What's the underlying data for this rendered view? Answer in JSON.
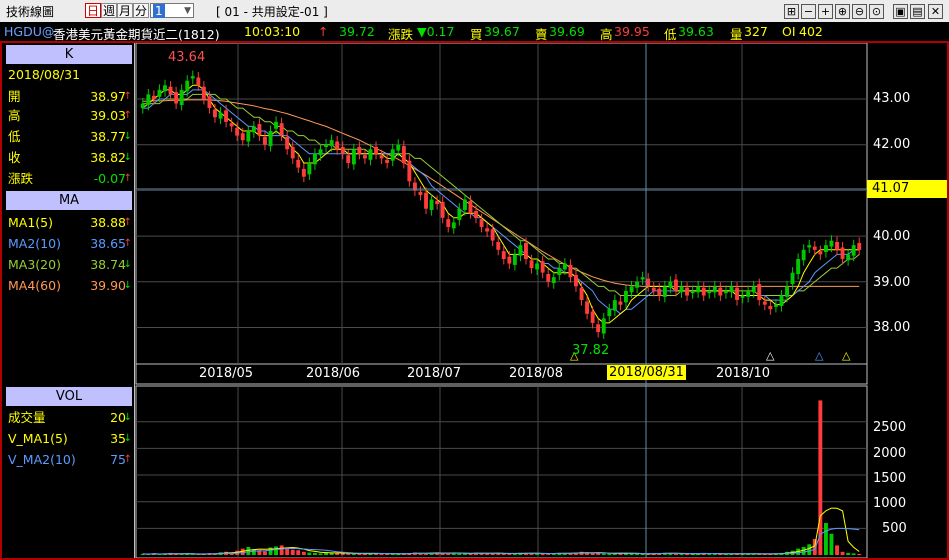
{
  "toolbar": {
    "title": "技術線圖",
    "periods": [
      "日",
      "週",
      "月",
      "分"
    ],
    "selected_period": "日",
    "interval_value": "1",
    "layout_label": "[ 01 - 共用設定-01 ]",
    "icons": [
      "pin-icon",
      "minus-icon",
      "plus-icon",
      "zoom-in-icon",
      "zoom-out-icon",
      "zoom-reset-icon",
      "save-icon",
      "print-icon",
      "close-icon"
    ]
  },
  "quote": {
    "symbol": "HGDU@",
    "name": "香港美元黃金期貨近二(1812)",
    "time": "10:03:10",
    "arrow": "↑",
    "price": "39.72",
    "change_label": "漲跌",
    "change": "▼0.17",
    "bid_label": "買",
    "bid": "39.67",
    "ask_label": "賣",
    "ask": "39.69",
    "high_label": "高",
    "high": "39.95",
    "low_label": "低",
    "low": "39.63",
    "vol_label": "量",
    "vol": "327",
    "oi_label": "OI",
    "oi": "402"
  },
  "k_panel": {
    "header": "K",
    "date": "2018/08/31",
    "rows": [
      {
        "label": "開",
        "value": "38.97",
        "arrow": "↑"
      },
      {
        "label": "高",
        "value": "39.03",
        "arrow": "↑"
      },
      {
        "label": "低",
        "value": "38.77",
        "arrow": "↓"
      },
      {
        "label": "收",
        "value": "38.82",
        "arrow": "↓"
      },
      {
        "label": "漲跌",
        "value": "-0.07",
        "arrow": "↑"
      }
    ]
  },
  "ma_panel": {
    "header": "MA",
    "rows": [
      {
        "label": "MA1(5)",
        "value": "38.88",
        "arrow": "↑",
        "color": "#ffff00"
      },
      {
        "label": "MA2(10)",
        "value": "38.65",
        "arrow": "↑",
        "color": "#5a9cff"
      },
      {
        "label": "MA3(20)",
        "value": "38.74",
        "arrow": "↓",
        "color": "#9acd32"
      },
      {
        "label": "MA4(60)",
        "value": "39.90",
        "arrow": "↓",
        "color": "#ff9955"
      }
    ]
  },
  "vol_panel": {
    "header": "VOL",
    "rows": [
      {
        "label": "成交量",
        "value": "20",
        "arrow": "↓",
        "color": "#ffff00"
      },
      {
        "label": "V_MA1(5)",
        "value": "35",
        "arrow": "↓",
        "color": "#ffff00"
      },
      {
        "label": "V_MA2(10)",
        "value": "75",
        "arrow": "↑",
        "color": "#5a9cff"
      }
    ]
  },
  "colors": {
    "up": "#00c800",
    "down": "#ff3c3c",
    "grid": "#505050",
    "crosshair": "#5b8fa8",
    "highlight": "#ffff00"
  },
  "chart_data": {
    "type": "candlestick",
    "price_axis": {
      "ticks": [
        "43.00",
        "42.00",
        "41.00",
        "40.00",
        "39.00",
        "38.00"
      ],
      "crosshair_value": "41.07"
    },
    "x_axis": {
      "ticks": [
        "2018/05",
        "2018/06",
        "2018/07",
        "2018/08",
        "2018/08/31",
        "2018/10"
      ],
      "highlighted": "2018/08/31"
    },
    "annotations": {
      "high_mark": "43.64",
      "low_mark": "37.82"
    },
    "volume_axis": {
      "ticks": [
        "2500",
        "2000",
        "1500",
        "1000",
        "500"
      ]
    },
    "series_close": [
      42.9,
      43.1,
      43.0,
      43.2,
      43.3,
      43.1,
      42.9,
      43.2,
      43.4,
      43.5,
      43.3,
      43.0,
      42.8,
      42.6,
      42.7,
      42.5,
      42.4,
      42.2,
      42.1,
      42.3,
      42.4,
      42.2,
      42.0,
      42.3,
      42.5,
      42.2,
      41.9,
      41.7,
      41.5,
      41.3,
      41.6,
      41.8,
      41.9,
      42.0,
      42.1,
      41.9,
      41.8,
      41.6,
      41.9,
      41.8,
      41.7,
      41.9,
      41.8,
      41.7,
      41.6,
      41.9,
      42.0,
      41.6,
      41.2,
      41.0,
      40.9,
      40.6,
      40.8,
      40.7,
      40.4,
      40.2,
      40.3,
      40.6,
      40.8,
      40.5,
      40.4,
      40.2,
      40.1,
      39.9,
      39.7,
      39.5,
      39.4,
      39.6,
      39.8,
      39.5,
      39.3,
      39.4,
      39.2,
      39.0,
      39.1,
      39.3,
      39.4,
      39.1,
      38.9,
      38.6,
      38.3,
      38.1,
      37.9,
      38.2,
      38.4,
      38.6,
      38.5,
      38.8,
      38.9,
      39.0,
      39.1,
      38.9,
      38.8,
      38.7,
      38.9,
      39.0,
      38.8,
      38.9,
      38.7,
      38.8,
      38.9,
      38.7,
      38.8,
      38.9,
      38.7,
      38.8,
      38.9,
      38.6,
      38.7,
      38.8,
      38.9,
      38.6,
      38.5,
      38.4,
      38.5,
      38.7,
      38.9,
      39.2,
      39.5,
      39.7,
      39.8,
      39.7,
      39.6,
      39.8,
      39.9,
      39.7,
      39.5,
      39.6,
      39.8,
      39.7
    ],
    "series_ma5": [
      42.8,
      42.9,
      43.0,
      43.1,
      43.2,
      43.2,
      43.1,
      43.1,
      43.2,
      43.3,
      43.3,
      43.2,
      43.0,
      42.8,
      42.7,
      42.6,
      42.5,
      42.4,
      42.3,
      42.3,
      42.3,
      42.2,
      42.2,
      42.2,
      42.3,
      42.2,
      42.1,
      41.9,
      41.8,
      41.6,
      41.6,
      41.6,
      41.7,
      41.8,
      41.9,
      41.9,
      41.9,
      41.8,
      41.8,
      41.8,
      41.8,
      41.8,
      41.8,
      41.8,
      41.7,
      41.7,
      41.8,
      41.7,
      41.6,
      41.4,
      41.2,
      41.0,
      40.9,
      40.8,
      40.7,
      40.5,
      40.4,
      40.4,
      40.5,
      40.5,
      40.5,
      40.4,
      40.3,
      40.2,
      40.0,
      39.8,
      39.6,
      39.6,
      39.6,
      39.6,
      39.5,
      39.5,
      39.4,
      39.3,
      39.2,
      39.2,
      39.2,
      39.2,
      39.1,
      38.9,
      38.7,
      38.4,
      38.2,
      38.1,
      38.1,
      38.2,
      38.3,
      38.4,
      38.6,
      38.7,
      38.8,
      38.9,
      38.9,
      38.9,
      38.9,
      38.9,
      38.8,
      38.8,
      38.8,
      38.8,
      38.8,
      38.8,
      38.8,
      38.8,
      38.8,
      38.8,
      38.8,
      38.7,
      38.7,
      38.7,
      38.7,
      38.7,
      38.6,
      38.6,
      38.5,
      38.5,
      38.6,
      38.7,
      38.9,
      39.2,
      39.4,
      39.6,
      39.7,
      39.7,
      39.7,
      39.7,
      39.7,
      39.7,
      39.7,
      39.7
    ],
    "series_ma10": [
      42.8,
      42.8,
      42.9,
      43.0,
      43.0,
      43.1,
      43.1,
      43.1,
      43.1,
      43.2,
      43.2,
      43.2,
      43.1,
      43.0,
      42.9,
      42.8,
      42.7,
      42.6,
      42.5,
      42.4,
      42.4,
      42.3,
      42.3,
      42.2,
      42.2,
      42.2,
      42.2,
      42.1,
      42.0,
      41.9,
      41.8,
      41.8,
      41.8,
      41.8,
      41.8,
      41.8,
      41.8,
      41.8,
      41.8,
      41.8,
      41.8,
      41.8,
      41.8,
      41.8,
      41.8,
      41.8,
      41.8,
      41.7,
      41.6,
      41.5,
      41.4,
      41.3,
      41.1,
      41.0,
      40.9,
      40.8,
      40.7,
      40.6,
      40.5,
      40.5,
      40.4,
      40.4,
      40.3,
      40.2,
      40.1,
      40.0,
      39.9,
      39.8,
      39.7,
      39.6,
      39.5,
      39.5,
      39.4,
      39.4,
      39.3,
      39.3,
      39.2,
      39.2,
      39.1,
      39.0,
      38.9,
      38.8,
      38.6,
      38.5,
      38.4,
      38.4,
      38.3,
      38.4,
      38.4,
      38.5,
      38.6,
      38.7,
      38.8,
      38.8,
      38.8,
      38.8,
      38.8,
      38.8,
      38.8,
      38.8,
      38.8,
      38.8,
      38.8,
      38.8,
      38.8,
      38.8,
      38.8,
      38.7,
      38.7,
      38.7,
      38.7,
      38.7,
      38.7,
      38.6,
      38.6,
      38.6,
      38.6,
      38.7,
      38.8,
      38.9,
      39.0,
      39.2,
      39.3,
      39.4,
      39.5,
      39.6,
      39.6,
      39.6,
      39.7,
      39.7
    ],
    "series_ma20": [
      42.9,
      42.9,
      42.9,
      42.9,
      43.0,
      43.0,
      43.0,
      43.0,
      43.0,
      43.1,
      43.1,
      43.1,
      43.1,
      43.1,
      43.0,
      43.0,
      42.9,
      42.8,
      42.8,
      42.7,
      42.6,
      42.6,
      42.5,
      42.5,
      42.4,
      42.4,
      42.3,
      42.3,
      42.2,
      42.2,
      42.1,
      42.1,
      42.0,
      42.0,
      42.0,
      41.9,
      41.9,
      41.9,
      41.9,
      41.9,
      41.9,
      41.8,
      41.8,
      41.8,
      41.8,
      41.8,
      41.8,
      41.8,
      41.8,
      41.7,
      41.7,
      41.6,
      41.5,
      41.4,
      41.3,
      41.2,
      41.1,
      41.0,
      40.9,
      40.8,
      40.7,
      40.6,
      40.5,
      40.4,
      40.3,
      40.2,
      40.1,
      40.0,
      39.9,
      39.9,
      39.8,
      39.7,
      39.6,
      39.5,
      39.5,
      39.4,
      39.4,
      39.3,
      39.3,
      39.2,
      39.1,
      39.0,
      38.9,
      38.9,
      38.8,
      38.8,
      38.7,
      38.7,
      38.7,
      38.7,
      38.7,
      38.7,
      38.7,
      38.7,
      38.7,
      38.7,
      38.7,
      38.8,
      38.8,
      38.8,
      38.8,
      38.8,
      38.8,
      38.8,
      38.8,
      38.8,
      38.8,
      38.8,
      38.8,
      38.8,
      38.8,
      38.7,
      38.7,
      38.7,
      38.7,
      38.7,
      38.7,
      38.7,
      38.8,
      38.8,
      38.9,
      39.0,
      39.1,
      39.2,
      39.3,
      39.3,
      39.4,
      39.5,
      39.5,
      39.6
    ],
    "series_ma60": [
      42.95,
      42.95,
      42.96,
      42.96,
      42.96,
      42.97,
      42.97,
      42.97,
      42.98,
      42.98,
      42.98,
      42.98,
      42.98,
      42.97,
      42.96,
      42.95,
      42.93,
      42.91,
      42.89,
      42.87,
      42.85,
      42.82,
      42.79,
      42.77,
      42.74,
      42.71,
      42.68,
      42.64,
      42.6,
      42.56,
      42.52,
      42.48,
      42.44,
      42.4,
      42.35,
      42.3,
      42.25,
      42.2,
      42.15,
      42.1,
      42.04,
      41.98,
      41.92,
      41.86,
      41.8,
      41.74,
      41.68,
      41.61,
      41.54,
      41.47,
      41.4,
      41.33,
      41.25,
      41.17,
      41.09,
      41.01,
      40.93,
      40.85,
      40.77,
      40.69,
      40.61,
      40.53,
      40.45,
      40.37,
      40.29,
      40.21,
      40.13,
      40.05,
      39.97,
      39.9,
      39.82,
      39.74,
      39.66,
      39.59,
      39.52,
      39.45,
      39.38,
      39.32,
      39.26,
      39.21,
      39.16,
      39.11,
      39.07,
      39.03,
      39.0,
      38.97,
      38.95,
      38.93,
      38.92,
      38.91,
      38.9,
      38.9,
      38.9,
      38.9,
      38.9,
      38.9,
      38.9,
      38.9,
      38.9,
      38.9,
      38.9,
      38.9,
      38.9,
      38.9,
      38.9,
      38.9,
      38.9,
      38.9,
      38.9,
      38.9,
      38.9,
      38.9,
      38.9,
      38.9,
      38.9,
      38.9,
      38.9,
      38.9,
      38.9,
      38.9,
      38.9,
      38.9,
      38.9,
      38.9,
      38.9,
      38.9,
      38.9,
      38.9,
      38.9,
      38.9
    ],
    "series_volume": [
      20,
      15,
      30,
      10,
      25,
      40,
      20,
      15,
      30,
      12,
      8,
      20,
      35,
      25,
      50,
      60,
      40,
      80,
      120,
      150,
      110,
      90,
      70,
      140,
      160,
      180,
      120,
      100,
      90,
      60,
      45,
      40,
      30,
      50,
      35,
      40,
      30,
      25,
      20,
      25,
      30,
      35,
      28,
      22,
      18,
      30,
      25,
      20,
      35,
      45,
      30,
      25,
      40,
      50,
      35,
      28,
      30,
      40,
      25,
      20,
      45,
      38,
      30,
      35,
      28,
      22,
      25,
      30,
      40,
      35,
      30,
      25,
      20,
      28,
      35,
      40,
      30,
      25,
      45,
      60,
      50,
      40,
      30,
      25,
      20,
      35,
      40,
      30,
      25,
      20,
      18,
      25,
      30,
      35,
      40,
      30,
      25,
      20,
      22,
      28,
      30,
      35,
      25,
      20,
      18,
      22,
      25,
      30,
      28,
      20,
      15,
      18,
      22,
      25,
      30,
      40,
      60,
      80,
      120,
      150,
      200,
      300,
      2900,
      600,
      400,
      180,
      60,
      40,
      30,
      20
    ]
  }
}
